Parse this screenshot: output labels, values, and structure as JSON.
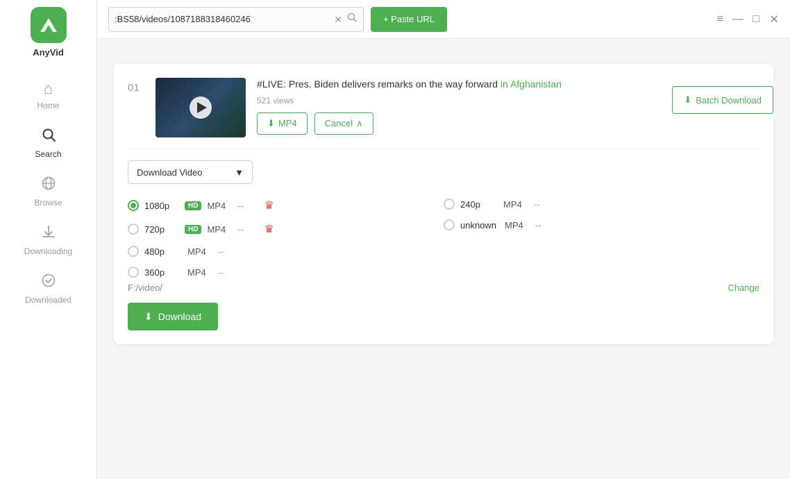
{
  "app": {
    "name": "AnyVid",
    "logo_letter": "A"
  },
  "titlebar": {
    "url_value": ":BS58/videos/1087188318460246",
    "paste_url_label": "+ Paste URL"
  },
  "window_controls": {
    "menu_icon": "≡",
    "minimize_icon": "—",
    "maximize_icon": "□",
    "close_icon": "✕"
  },
  "batch_download": {
    "label": "Batch Download",
    "icon": "⬇"
  },
  "sidebar": {
    "items": [
      {
        "id": "home",
        "label": "Home",
        "icon": "⌂",
        "active": false
      },
      {
        "id": "search",
        "label": "Search",
        "icon": "🔍",
        "active": true
      },
      {
        "id": "browse",
        "label": "Browse",
        "icon": "◎",
        "active": false
      },
      {
        "id": "downloading",
        "label": "Downloading",
        "icon": "⬇",
        "active": false
      },
      {
        "id": "downloaded",
        "label": "Downloaded",
        "icon": "✓",
        "active": false
      }
    ]
  },
  "video": {
    "number": "01",
    "title_prefix": "#LIVE: Pres. Biden delivers remarks on the way forward",
    "title_highlight": " in Afghanistan",
    "views": "521 views",
    "mp4_btn": "MP4",
    "cancel_btn": "Cancel"
  },
  "download_options": {
    "type_label": "Download Video",
    "qualities": [
      {
        "id": "1080p",
        "label": "1080p",
        "hd": true,
        "format": "MP4",
        "size": "--",
        "premium": true,
        "selected": true,
        "col": 0
      },
      {
        "id": "240p",
        "label": "240p",
        "hd": false,
        "format": "MP4",
        "size": "--",
        "premium": false,
        "selected": false,
        "col": 1
      },
      {
        "id": "720p",
        "label": "720p",
        "hd": true,
        "format": "MP4",
        "size": "--",
        "premium": true,
        "selected": false,
        "col": 0
      },
      {
        "id": "unknown",
        "label": "unknown",
        "hd": false,
        "format": "MP4",
        "size": "--",
        "premium": false,
        "selected": false,
        "col": 1
      },
      {
        "id": "480p",
        "label": "480p",
        "hd": false,
        "format": "MP4",
        "size": "--",
        "premium": false,
        "selected": false,
        "col": 0
      },
      {
        "id": "360p",
        "label": "360p",
        "hd": false,
        "format": "MP4",
        "size": "--",
        "premium": false,
        "selected": false,
        "col": 0
      }
    ],
    "save_path": "F:/video/",
    "change_label": "Change",
    "download_btn": "Download",
    "download_icon": "⬇"
  },
  "colors": {
    "green": "#4CAF50",
    "red": "#e74c3c",
    "grey_text": "#999",
    "border": "#d0d0d0"
  }
}
